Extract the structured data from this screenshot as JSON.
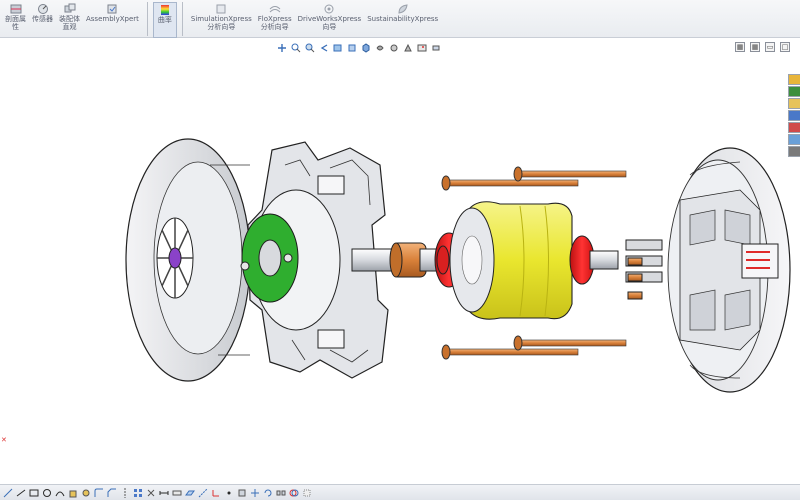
{
  "ribbon": {
    "buttons": [
      {
        "label": "剖面属\n性",
        "icon": "section-properties-icon"
      },
      {
        "label": "传感器",
        "icon": "sensor-icon"
      },
      {
        "label": "装配体\n直观",
        "icon": "assembly-visualization-icon"
      },
      {
        "label": "AssemblyXpert",
        "icon": "assemblyxpert-icon"
      },
      {
        "label": "曲率",
        "icon": "curvature-icon"
      },
      {
        "label": "SimulationXpress\n分析向导",
        "icon": "simulationxpress-icon"
      },
      {
        "label": "FloXpress\n分析向导",
        "icon": "floxpress-icon"
      },
      {
        "label": "DriveWorksXpress\n向导",
        "icon": "driveworksxpress-icon"
      },
      {
        "label": "SustainabilityXpress",
        "icon": "sustainabilityxpress-icon"
      }
    ]
  },
  "view_toolbar": {
    "icons": [
      "view-orientation-icon",
      "zoom-to-fit-icon",
      "zoom-area-icon",
      "previous-view-icon",
      "section-view-icon",
      "dynamic-annotation-icon",
      "view-orientation-cube-icon",
      "display-style-icon",
      "hide-show-items-icon",
      "edit-appearance-icon",
      "apply-scene-icon",
      "view-settings-icon"
    ]
  },
  "taskpane": {
    "buttons": [
      {
        "icon": "solidworks-resources-icon",
        "color": "#e8b53a"
      },
      {
        "icon": "design-library-icon",
        "color": "#3d8f3d"
      },
      {
        "icon": "file-explorer-icon",
        "color": "#e6c35a"
      },
      {
        "icon": "view-palette-icon",
        "color": "#4a78c8"
      },
      {
        "icon": "appearances-icon",
        "color": "#d04a4a"
      },
      {
        "icon": "custom-properties-icon",
        "color": "#6aa0d8"
      },
      {
        "icon": "solidworks-forum-icon",
        "color": "#7a7a7a"
      }
    ]
  },
  "colors": {
    "accent_green": "#2fae2f",
    "accent_yellow": "#ecea3a",
    "accent_red": "#e02a2a",
    "accent_orange": "#d98a3a",
    "part_gray": "#d8dade"
  }
}
